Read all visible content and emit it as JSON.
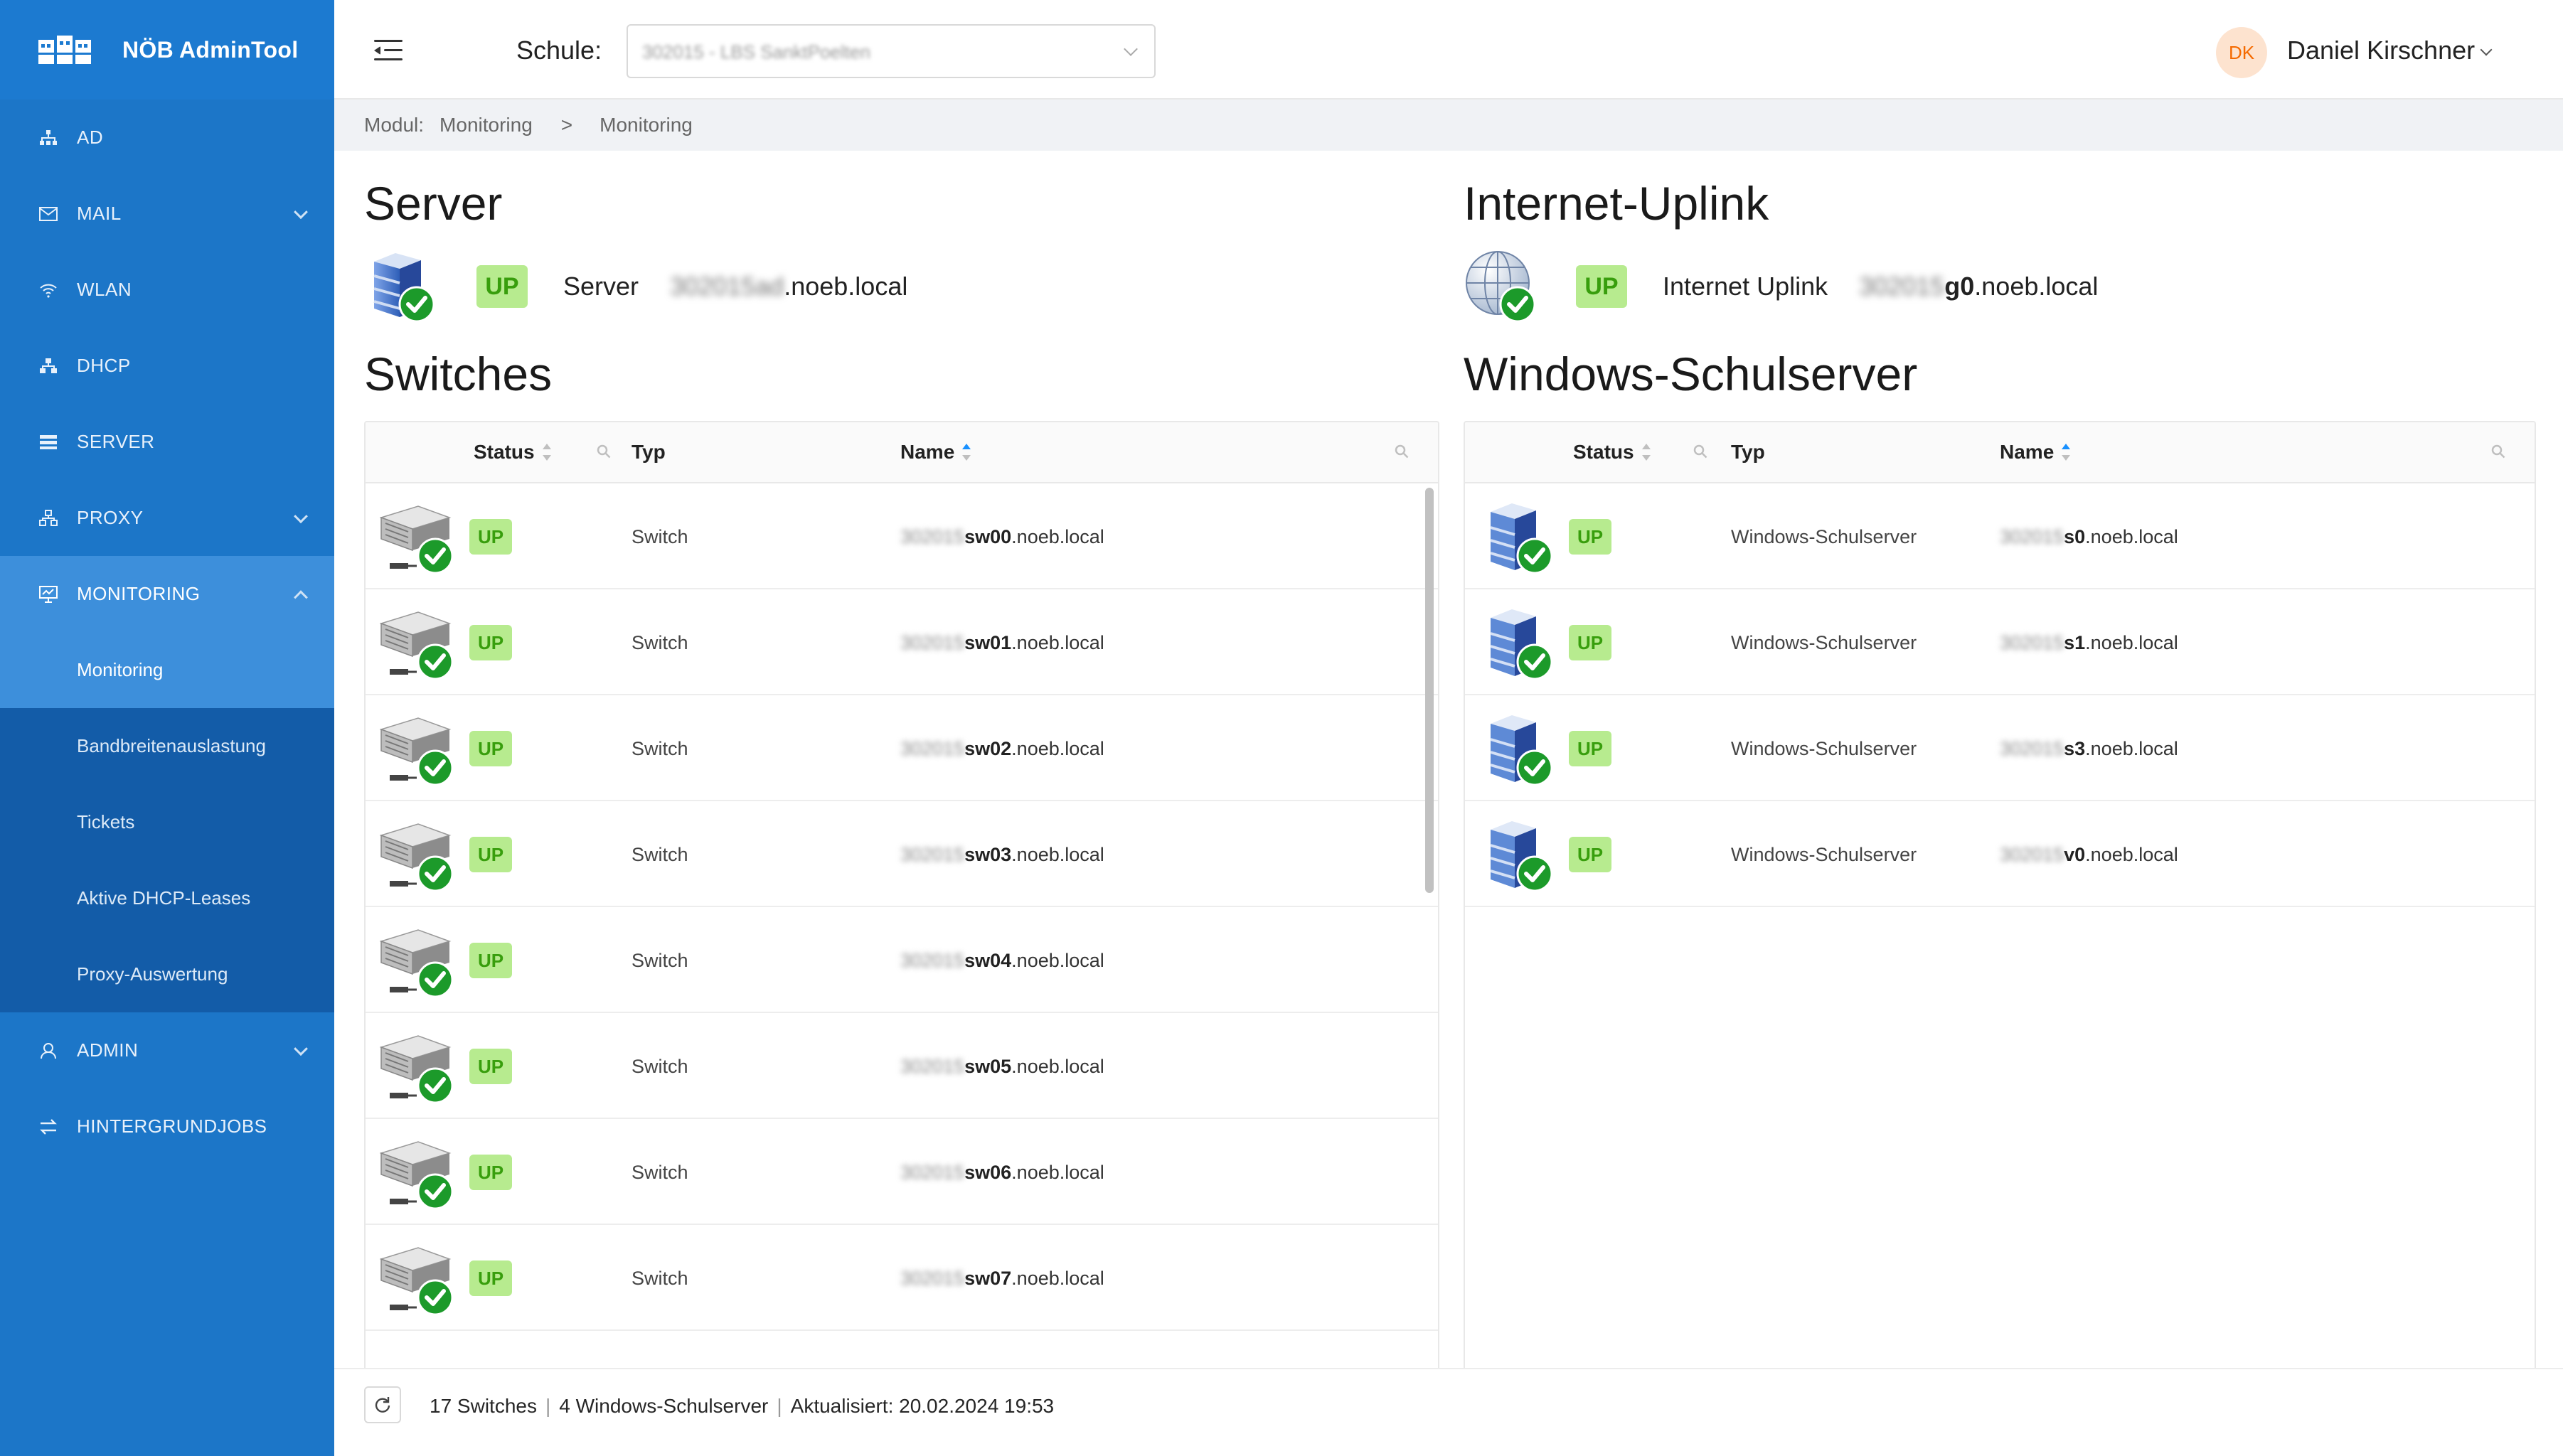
{
  "app": {
    "title": "NÖB AdminTool"
  },
  "nav": {
    "items": [
      {
        "label": "AD",
        "icon": "sitemap-icon"
      },
      {
        "label": "MAIL",
        "icon": "mail-icon"
      },
      {
        "label": "WLAN",
        "icon": "wifi-icon"
      },
      {
        "label": "DHCP",
        "icon": "network-icon"
      },
      {
        "label": "SERVER",
        "icon": "server-icon"
      },
      {
        "label": "PROXY",
        "icon": "cluster-icon"
      },
      {
        "label": "MONITORING",
        "icon": "monitor-icon"
      }
    ],
    "monitoring_sub": [
      {
        "label": "Monitoring"
      },
      {
        "label": "Bandbreitenauslastung"
      },
      {
        "label": "Tickets"
      },
      {
        "label": "Aktive DHCP-Leases"
      },
      {
        "label": "Proxy-Auswertung"
      }
    ],
    "items_after": [
      {
        "label": "ADMIN",
        "icon": "user-icon"
      },
      {
        "label": "HINTERGRUNDJOBS",
        "icon": "swap-icon"
      }
    ]
  },
  "header": {
    "school_label": "Schule:",
    "school_value": "302015 - LBS SanktPoelten",
    "user_initials": "DK",
    "user_name": "Daniel Kirschner"
  },
  "breadcrumb": {
    "modul_label": "Modul:",
    "level1": "Monitoring",
    "separator": ">",
    "level2": "Monitoring"
  },
  "server_section": {
    "title": "Server",
    "status": "UP",
    "label": "Server",
    "host_prefix": "302015",
    "host_suffix": "ad",
    "host_domain": ".noeb.local"
  },
  "uplink_section": {
    "title": "Internet-Uplink",
    "status": "UP",
    "label": "Internet Uplink",
    "host_prefix": "302015",
    "host_suffix": "g0",
    "host_domain": ".noeb.local"
  },
  "switches": {
    "title": "Switches",
    "columns": {
      "status": "Status",
      "typ": "Typ",
      "name": "Name"
    },
    "rows": [
      {
        "status": "UP",
        "typ": "Switch",
        "prefix": "302015",
        "suffix": "sw00",
        "domain": ".noeb.local"
      },
      {
        "status": "UP",
        "typ": "Switch",
        "prefix": "302015",
        "suffix": "sw01",
        "domain": ".noeb.local"
      },
      {
        "status": "UP",
        "typ": "Switch",
        "prefix": "302015",
        "suffix": "sw02",
        "domain": ".noeb.local"
      },
      {
        "status": "UP",
        "typ": "Switch",
        "prefix": "302015",
        "suffix": "sw03",
        "domain": ".noeb.local"
      },
      {
        "status": "UP",
        "typ": "Switch",
        "prefix": "302015",
        "suffix": "sw04",
        "domain": ".noeb.local"
      },
      {
        "status": "UP",
        "typ": "Switch",
        "prefix": "302015",
        "suffix": "sw05",
        "domain": ".noeb.local"
      },
      {
        "status": "UP",
        "typ": "Switch",
        "prefix": "302015",
        "suffix": "sw06",
        "domain": ".noeb.local"
      },
      {
        "status": "UP",
        "typ": "Switch",
        "prefix": "302015",
        "suffix": "sw07",
        "domain": ".noeb.local"
      }
    ]
  },
  "windows": {
    "title": "Windows-Schulserver",
    "columns": {
      "status": "Status",
      "typ": "Typ",
      "name": "Name"
    },
    "rows": [
      {
        "status": "UP",
        "typ": "Windows-Schulserver",
        "prefix": "302015",
        "suffix": "s0",
        "domain": ".noeb.local"
      },
      {
        "status": "UP",
        "typ": "Windows-Schulserver",
        "prefix": "302015",
        "suffix": "s1",
        "domain": ".noeb.local"
      },
      {
        "status": "UP",
        "typ": "Windows-Schulserver",
        "prefix": "302015",
        "suffix": "s3",
        "domain": ".noeb.local"
      },
      {
        "status": "UP",
        "typ": "Windows-Schulserver",
        "prefix": "302015",
        "suffix": "v0",
        "domain": ".noeb.local"
      }
    ]
  },
  "footer": {
    "switch_count": "17 Switches",
    "windows_count": "4 Windows-Schulserver",
    "updated": "Aktualisiert: 20.02.2024 19:53",
    "separator": "|"
  },
  "colors": {
    "sidebar": "#1c76c8",
    "sidebar_sub": "#135ca8",
    "active": "#3d8fdb",
    "up_bg": "#b7eb8f",
    "up_text": "#389e0d"
  }
}
